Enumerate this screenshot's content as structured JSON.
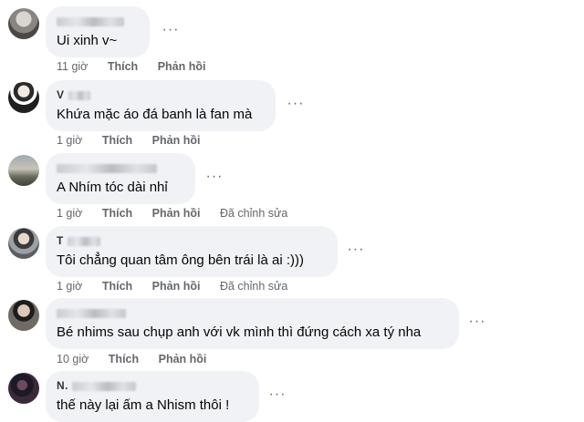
{
  "comments": [
    {
      "name": "",
      "text": "Ui xinh v~",
      "time": "11 giờ",
      "like": "Thích",
      "reply": "Phản hồi",
      "edited": ""
    },
    {
      "name": "V",
      "text": "Khứa mặc áo đá banh là fan mà",
      "time": "1 giờ",
      "like": "Thích",
      "reply": "Phản hồi",
      "edited": ""
    },
    {
      "name": "",
      "text": "A Nhím tóc dài nhỉ",
      "time": "1 giờ",
      "like": "Thích",
      "reply": "Phản hồi",
      "edited": "Đã chỉnh sửa"
    },
    {
      "name": "T",
      "text": "Tôi chẳng quan tâm ông bên trái là ai :)))",
      "time": "1 giờ",
      "like": "Thích",
      "reply": "Phản hồi",
      "edited": "Đã chỉnh sửa"
    },
    {
      "name": "",
      "text": "Bé nhims sau chụp anh với vk mình thì đứng cách xa tý nha",
      "time": "10 giờ",
      "like": "Thích",
      "reply": "Phản hồi",
      "edited": ""
    },
    {
      "name": "N.",
      "text": "thế này lại ấm a Nhism thôi !",
      "time": "",
      "like": "",
      "reply": "",
      "edited": ""
    }
  ],
  "icons": {
    "more": "more-options-icon"
  }
}
